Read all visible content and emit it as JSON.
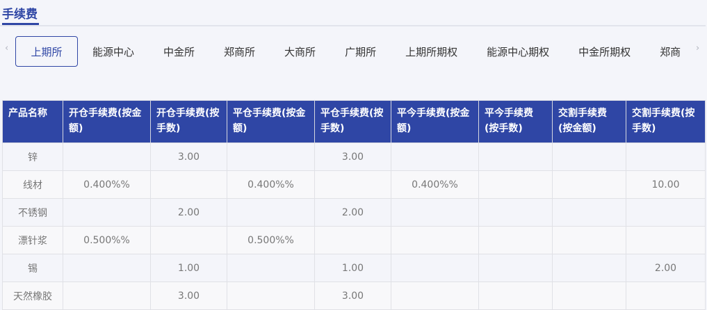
{
  "title": "手续费",
  "tabs": [
    "上期所",
    "能源中心",
    "中金所",
    "郑商所",
    "大商所",
    "广期所",
    "上期所期权",
    "能源中心期权",
    "中金所期权",
    "郑商"
  ],
  "columns": [
    "产品名称",
    "开仓手续费(按金额)",
    "开仓手续费(按手数)",
    "平仓手续费(按金额)",
    "平仓手续费(按手数)",
    "平今手续费(按金额)",
    "平今手续费(按手数)",
    "交割手续费(按金额)",
    "交割手续费(按手数)"
  ],
  "rows": [
    [
      "锌",
      "",
      "3.00",
      "",
      "3.00",
      "",
      "",
      "",
      ""
    ],
    [
      "线材",
      "0.400%%",
      "",
      "0.400%%",
      "",
      "0.400%%",
      "",
      "",
      "10.00"
    ],
    [
      "不锈钢",
      "",
      "2.00",
      "",
      "2.00",
      "",
      "",
      "",
      ""
    ],
    [
      "漂针浆",
      "0.500%%",
      "",
      "0.500%%",
      "",
      "",
      "",
      "",
      ""
    ],
    [
      "锡",
      "",
      "1.00",
      "",
      "1.00",
      "",
      "",
      "",
      "2.00"
    ],
    [
      "天然橡胶",
      "",
      "3.00",
      "",
      "3.00",
      "",
      "",
      "",
      ""
    ]
  ]
}
